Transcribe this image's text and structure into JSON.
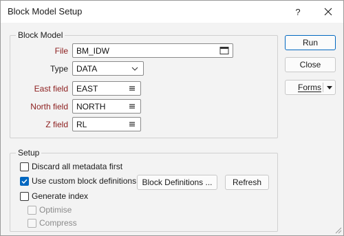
{
  "window": {
    "title": "Block Model Setup",
    "help_label": "?",
    "close_label": "✕"
  },
  "block_model": {
    "group_label": "Block Model",
    "file_label": "File",
    "file_value": "BM_IDW",
    "type_label": "Type",
    "type_value": "DATA",
    "east_label": "East field",
    "east_value": "EAST",
    "north_label": "North field",
    "north_value": "NORTH",
    "z_label": "Z field",
    "z_value": "RL"
  },
  "actions": {
    "run_label": "Run",
    "close_label": "Close",
    "forms_label": "Forms"
  },
  "setup": {
    "group_label": "Setup",
    "discard_label": "Discard all metadata first",
    "discard_checked": false,
    "custom_label": "Use custom block definitions",
    "custom_checked": true,
    "block_defs_label": "Block Definitions ...",
    "refresh_label": "Refresh",
    "generate_label": "Generate index",
    "generate_checked": false,
    "optimise_label": "Optimise",
    "optimise_checked": false,
    "compress_label": "Compress",
    "compress_checked": false
  },
  "colors": {
    "accent": "#0067c0",
    "required_label": "#8b1c1c"
  }
}
